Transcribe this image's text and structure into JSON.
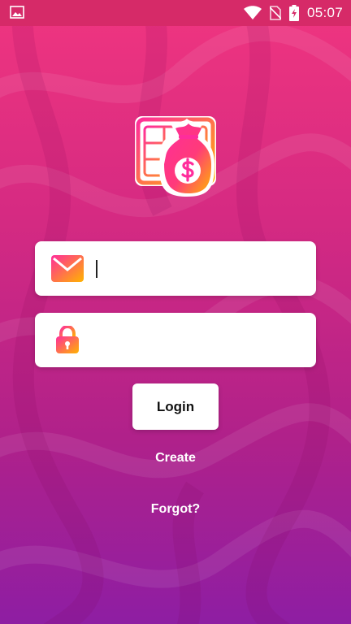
{
  "status_bar": {
    "time": "05:07",
    "icons": [
      "image-icon",
      "wifi-icon",
      "no-sim-icon",
      "battery-charging-icon"
    ]
  },
  "app": {
    "logo_icon": "money-bag-card-icon"
  },
  "login_form": {
    "email": {
      "icon": "mail-icon",
      "value": "",
      "placeholder": ""
    },
    "password": {
      "icon": "lock-icon",
      "value": "",
      "placeholder": ""
    },
    "login_label": "Login",
    "create_label": "Create",
    "forgot_label": "Forgot?"
  },
  "colors": {
    "background_top": "#f0357f",
    "background_bottom": "#8e1ea3",
    "status_bar": "#d62a68",
    "icon_gradient_start": "#ff2d9b",
    "icon_gradient_end": "#ffb400",
    "field_background": "#ffffff"
  }
}
